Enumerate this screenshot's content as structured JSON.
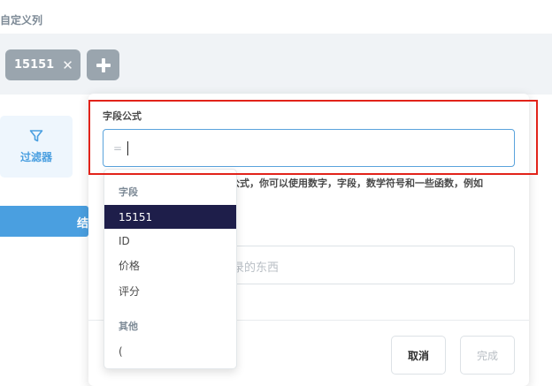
{
  "header": {
    "title": "自定义列"
  },
  "column_chips": [
    {
      "label": "15151"
    }
  ],
  "sidebar": {
    "filter_label": "过滤器",
    "button_partial": "结"
  },
  "formula_panel": {
    "title": "字段公式",
    "input_prefix": "=",
    "help_text": "公式，你可以使用数字，字段，数学符号和一些函数，例如",
    "name_placeholder": "录的东西",
    "cancel_label": "取消",
    "done_label": "完成"
  },
  "dropdown": {
    "fields_heading": "字段",
    "fields": [
      "15151",
      "ID",
      "价格",
      "评分"
    ],
    "selected": "15151",
    "other_heading": "其他",
    "other": [
      "("
    ]
  },
  "colors": {
    "accent": "#4a9fe0",
    "selected_bg": "#1e1e4a",
    "highlight": "#e2231a"
  }
}
